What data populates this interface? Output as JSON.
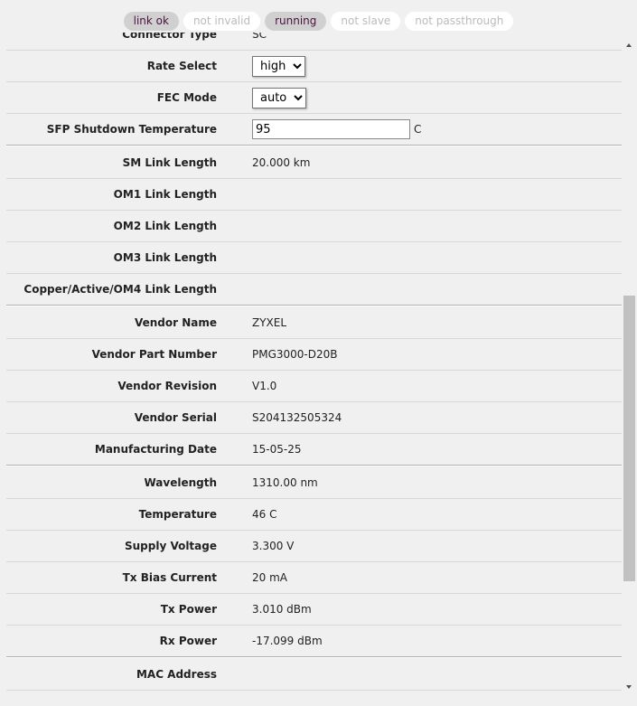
{
  "status": [
    "link ok",
    "not invalid",
    "running",
    "not slave",
    "not passthrough"
  ],
  "status_active": [
    true,
    false,
    true,
    false,
    false
  ],
  "groups": [
    [
      {
        "label": "Connector Type",
        "value": "SC"
      },
      {
        "label": "Rate Select",
        "select": "high"
      },
      {
        "label": "FEC Mode",
        "select": "auto"
      },
      {
        "label": "SFP Shutdown Temperature",
        "input": "95",
        "unit": "C"
      }
    ],
    [
      {
        "label": "SM Link Length",
        "value": "20.000 km"
      },
      {
        "label": "OM1 Link Length",
        "value": ""
      },
      {
        "label": "OM2 Link Length",
        "value": ""
      },
      {
        "label": "OM3 Link Length",
        "value": ""
      },
      {
        "label": "Copper/Active/OM4 Link Length",
        "value": ""
      }
    ],
    [
      {
        "label": "Vendor Name",
        "value": "ZYXEL"
      },
      {
        "label": "Vendor Part Number",
        "value": "PMG3000-D20B"
      },
      {
        "label": "Vendor Revision",
        "value": "V1.0"
      },
      {
        "label": "Vendor Serial",
        "value": "S204132505324"
      },
      {
        "label": "Manufacturing Date",
        "value": "15-05-25"
      }
    ],
    [
      {
        "label": "Wavelength",
        "value": "1310.00 nm"
      },
      {
        "label": "Temperature",
        "value": "46 C"
      },
      {
        "label": "Supply Voltage",
        "value": "3.300 V"
      },
      {
        "label": "Tx Bias Current",
        "value": "20 mA"
      },
      {
        "label": "Tx Power",
        "value": "3.010 dBm"
      },
      {
        "label": "Rx Power",
        "value": "-17.099 dBm"
      }
    ],
    [
      {
        "label": "MAC Address",
        "value": ""
      }
    ]
  ]
}
